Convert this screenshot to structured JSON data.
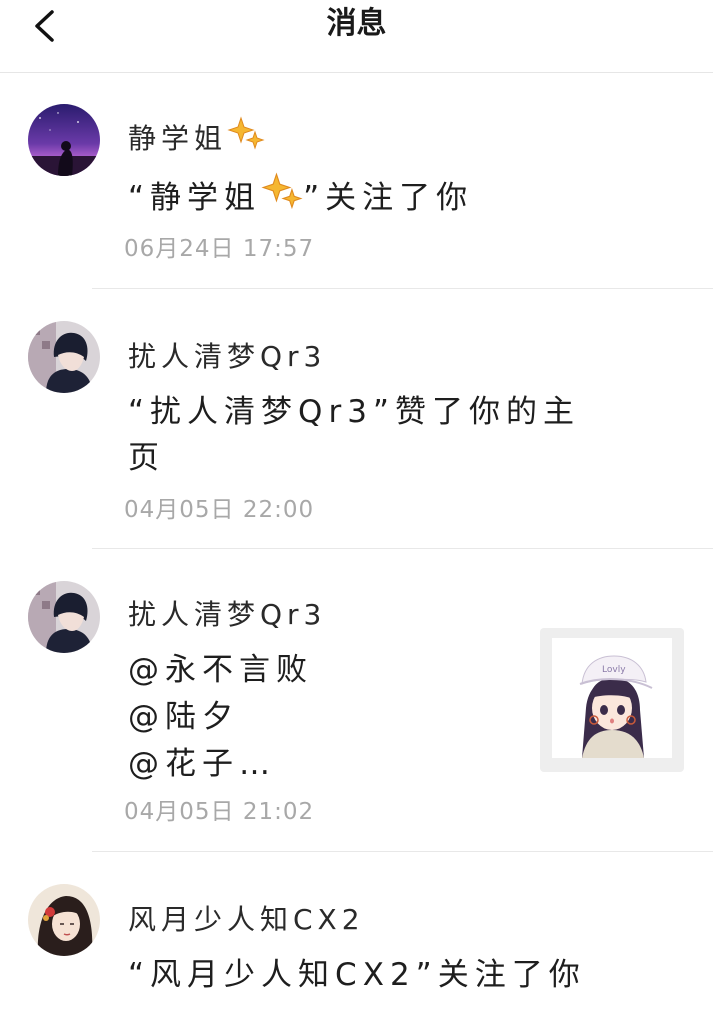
{
  "header": {
    "title": "消息",
    "back_icon": "chevron-left-icon"
  },
  "messages": [
    {
      "sender": "静学姐",
      "sender_badge_icon": "sparkles-icon",
      "text_open": "“静学姐",
      "text_close": "”关注了你",
      "time": "06月24日 17:57"
    },
    {
      "sender": "扰人清梦Qr3",
      "text": "“扰人清梦Qr3”赞了你的主\n页",
      "time": "04月05日 22:00"
    },
    {
      "sender": "扰人清梦Qr3",
      "text": "@永不言败\n@陆夕\n@花子…",
      "time": "04月05日 21:02",
      "thumbnail_icon": "anime-girl-thumbnail"
    },
    {
      "sender": "风月少人知CX2",
      "text": "“风月少人知CX2”关注了你"
    }
  ],
  "colors": {
    "time_text": "#a8a8a8",
    "divider": "#e8e8e8",
    "sparkle": "#f5b731"
  }
}
